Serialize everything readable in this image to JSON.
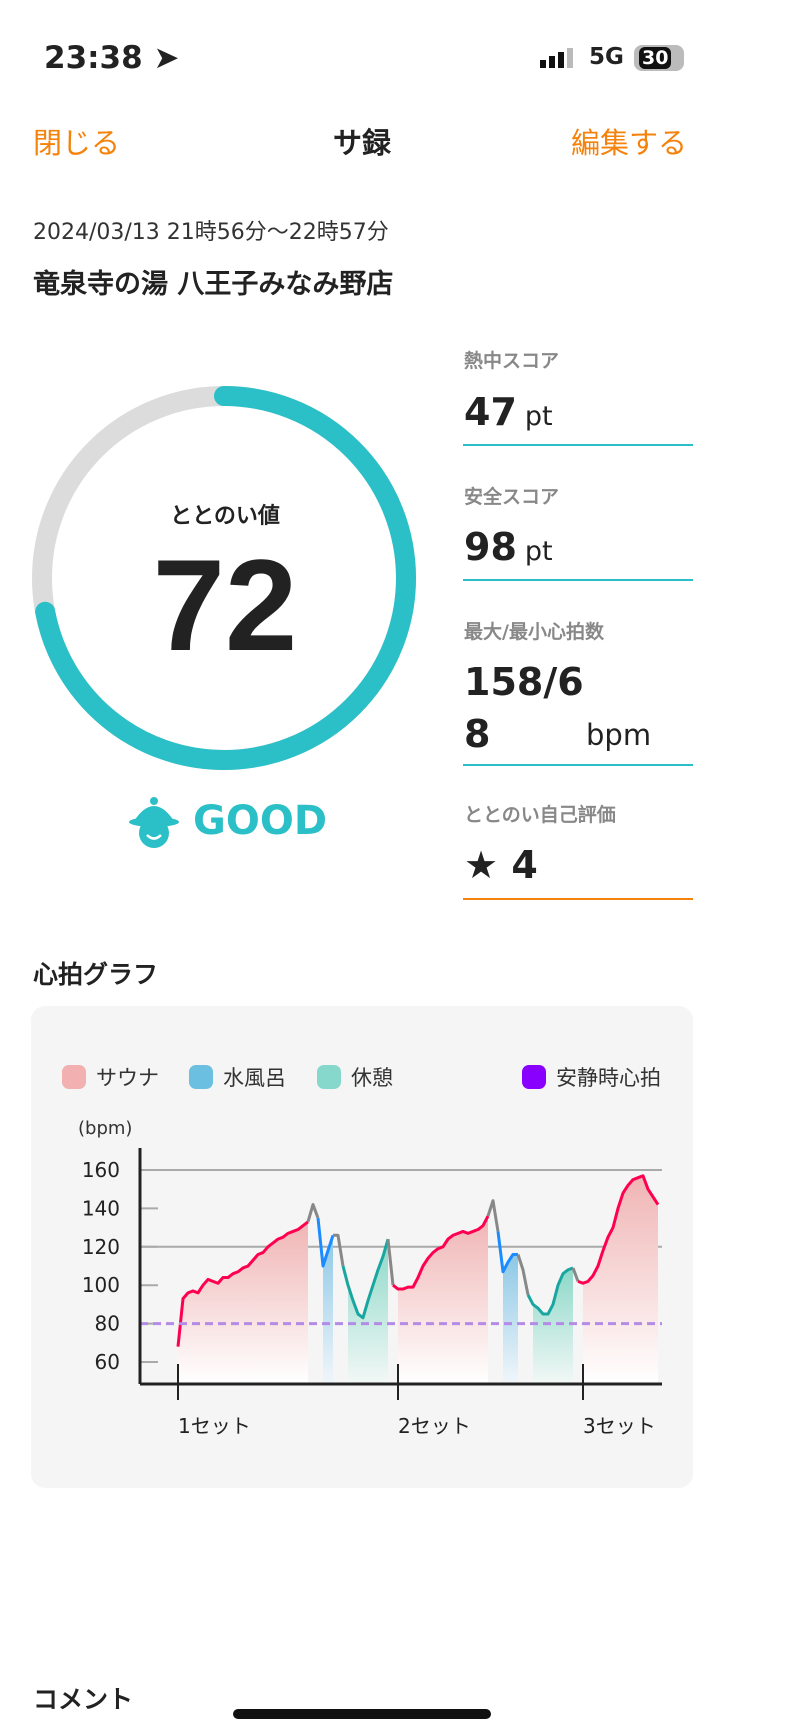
{
  "status": {
    "time": "23:38",
    "network": "5G",
    "battery": "30"
  },
  "nav": {
    "close": "閉じる",
    "title": "サ録",
    "edit": "編集する"
  },
  "session": {
    "datetime": "2024/03/13 21時56分〜22時57分",
    "place": "竜泉寺の湯 八王子みなみ野店"
  },
  "gauge": {
    "label": "ととのい値",
    "value": "72",
    "percent": 72,
    "rating": "GOOD",
    "color": "#2bbfc7"
  },
  "scores": [
    {
      "label": "熱中スコア",
      "value": "47",
      "unit": "pt"
    },
    {
      "label": "安全スコア",
      "value": "98",
      "unit": "pt"
    },
    {
      "label": "最大/最小心拍数",
      "value_line1": "158/6",
      "value_line2": "8",
      "unit": "bpm"
    },
    {
      "label": "ととのい自己評価",
      "value": "4",
      "icon": "star-icon"
    }
  ],
  "graph_title": "心拍グラフ",
  "comment_title": "コメント",
  "chart_data": {
    "type": "line",
    "ylabel": "(bpm)",
    "yticks": [
      60,
      80,
      100,
      120,
      140,
      160
    ],
    "ylim": [
      49,
      165
    ],
    "gridlines": [
      120,
      160
    ],
    "resting_hr": 80,
    "legend": [
      {
        "name": "サウナ",
        "color": "#f2b0b0"
      },
      {
        "name": "水風呂",
        "color": "#6bbfe0"
      },
      {
        "name": "休憩",
        "color": "#86d8cc"
      },
      {
        "name": "安静時心拍",
        "color": "#8a00ff"
      }
    ],
    "xticks": [
      {
        "label": "1セット",
        "index": 0
      },
      {
        "label": "2セット",
        "index": 44
      },
      {
        "label": "3セット",
        "index": 81
      }
    ],
    "segments": [
      {
        "phase": "sauna",
        "values": [
          68,
          93,
          96,
          97,
          96,
          100,
          103,
          102,
          101,
          104,
          104,
          106,
          107,
          109,
          110,
          113,
          116,
          117,
          120,
          122,
          124,
          125,
          127,
          128,
          129,
          131,
          133
        ]
      },
      {
        "phase": "transition",
        "values": [
          142,
          135
        ]
      },
      {
        "phase": "cold",
        "values": [
          110,
          118,
          126
        ]
      },
      {
        "phase": "transition",
        "values": [
          126,
          110
        ]
      },
      {
        "phase": "rest",
        "values": [
          100,
          92,
          85,
          83,
          92,
          100,
          108,
          115,
          124
        ]
      },
      {
        "phase": "transition",
        "values": [
          100
        ]
      },
      {
        "phase": "sauna",
        "values": [
          98,
          98,
          99,
          99,
          104,
          110,
          114,
          117,
          119,
          120,
          124,
          126,
          127,
          128,
          127,
          128,
          129,
          131,
          136
        ]
      },
      {
        "phase": "transition",
        "values": [
          144,
          128
        ]
      },
      {
        "phase": "cold",
        "values": [
          107,
          112,
          116,
          116
        ]
      },
      {
        "phase": "transition",
        "values": [
          108,
          95
        ]
      },
      {
        "phase": "rest",
        "values": [
          90,
          88,
          85,
          85,
          90,
          100,
          106,
          108,
          109
        ]
      },
      {
        "phase": "transition",
        "values": [
          102
        ]
      },
      {
        "phase": "sauna",
        "values": [
          101,
          102,
          105,
          110,
          118,
          125,
          130,
          140,
          148,
          152,
          155,
          156,
          157,
          150,
          146,
          142
        ]
      }
    ]
  }
}
